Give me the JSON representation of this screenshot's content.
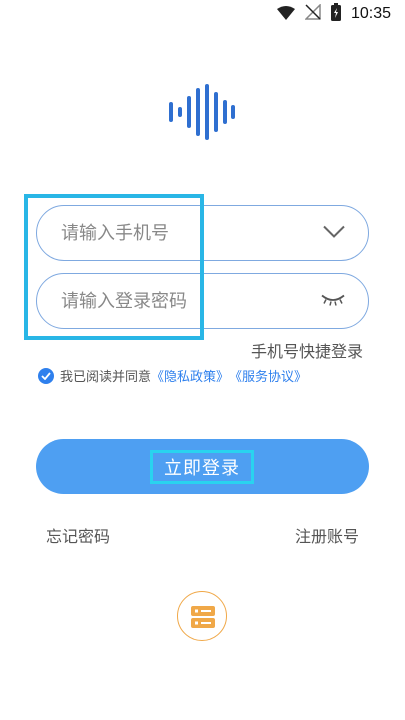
{
  "status_bar": {
    "time": "10:35",
    "icons": [
      "wifi-icon",
      "signal-off-icon",
      "battery-charging-icon"
    ]
  },
  "logo": {
    "icon": "sound-wave-icon",
    "color": "#2f6fd0"
  },
  "phone_field": {
    "placeholder": "请输入手机号",
    "value": "",
    "icon": "chevron-down-icon"
  },
  "password_field": {
    "placeholder": "请输入登录密码",
    "value": "",
    "icon": "eye-closed-icon"
  },
  "quick_login_label": "手机号快捷登录",
  "agreement": {
    "checked": true,
    "prefix": "我已阅读并同意",
    "privacy_link": "《隐私政策》",
    "service_link": "《服务协议》"
  },
  "login_button_label": "立即登录",
  "forgot_password_label": "忘记密码",
  "register_label": "注册账号",
  "server_button": {
    "icon": "server-icon"
  },
  "colors": {
    "accent": "#4e9ff2",
    "link": "#2f80ed",
    "field_border": "#7fa9e0",
    "server_orange": "#f0a848",
    "highlight": "#29b6e6"
  }
}
